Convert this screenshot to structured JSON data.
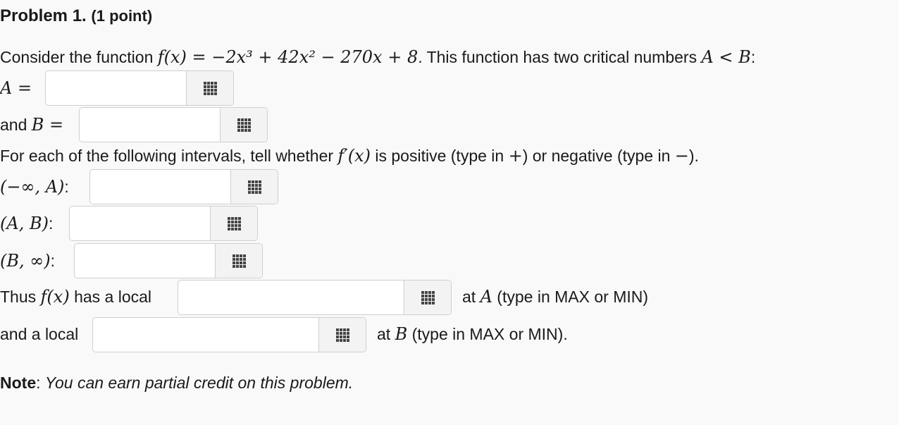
{
  "title": {
    "problem": "Problem 1.",
    "points": "(1 point)"
  },
  "intro": {
    "prefix": "Consider the function ",
    "function": "f(x) = −2x³ + 42x² − 270x + 8",
    "suffix": ". This function has two critical numbers ",
    "relation": "A < B",
    "colon": ":"
  },
  "a_label": "A =",
  "b_label_text": "and ",
  "b_label_math": "B =",
  "intervals_prompt": {
    "prefix": "For each of the following intervals, tell whether ",
    "deriv": "f′(x)",
    "middle": " is positive (type in ",
    "plus": "+",
    "middle2": ") or negative (type in ",
    "minus": "−",
    "end": ")."
  },
  "intervals": [
    "(−∞, A)",
    "(A, B)",
    "(B, ∞)"
  ],
  "interval_colon": ":",
  "local1": {
    "prefix": "Thus ",
    "fx": "f(x)",
    "mid": " has a local",
    "after": "at ",
    "var": "A",
    "hint": " (type in MAX or MIN)"
  },
  "local2": {
    "prefix": "and a local",
    "after": "at ",
    "var": "B",
    "hint": " (type in MAX or MIN)."
  },
  "note": {
    "label": "Note",
    "colon": ": ",
    "text": "You can earn partial credit on this problem."
  },
  "icon": "keyboard-grid-icon"
}
